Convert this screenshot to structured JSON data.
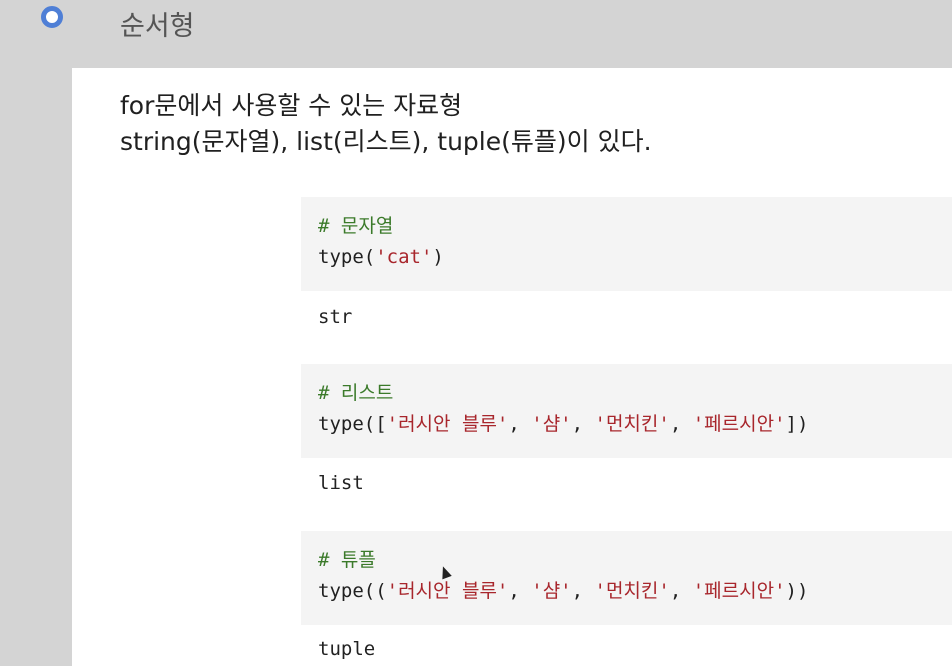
{
  "section": {
    "title": "순서형"
  },
  "description": {
    "line1": "for문에서 사용할 수 있는 자료형",
    "line2": "string(문자열), list(리스트), tuple(튜플)이 있다."
  },
  "cells": [
    {
      "comment": "# 문자열",
      "code_prefix": "type(",
      "strings": [
        "'cat'"
      ],
      "code_suffix": ")",
      "output": "str"
    },
    {
      "comment": "# 리스트",
      "code_prefix": "type([",
      "strings": [
        "'러시안 블루'",
        "'샴'",
        "'먼치킨'",
        "'페르시안'"
      ],
      "code_suffix": "])",
      "output": "list"
    },
    {
      "comment": "# 튜플",
      "code_prefix": "type((",
      "strings": [
        "'러시안 블루'",
        "'샴'",
        "'먼치킨'",
        "'페르시안'"
      ],
      "code_suffix": "))",
      "output": "tuple"
    }
  ],
  "colors": {
    "radio_accent": "#4f7fd6",
    "comment": "#3b7a2a",
    "string": "#a8262c"
  }
}
